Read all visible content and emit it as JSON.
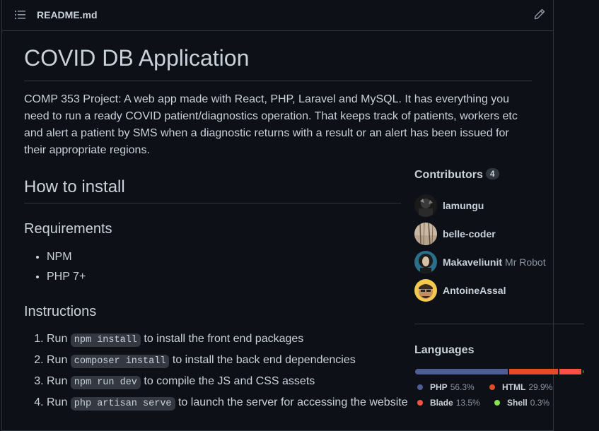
{
  "readme": {
    "filename": "README.md",
    "title": "COVID DB Application",
    "description": "COMP 353 Project: A web app made with React, PHP, Laravel and MySQL. It has everything you need to run a ready COVID patient/diagnostics operation. That keeps track of patients, workers etc and alert a patient by SMS when a diagnostic returns with a result or an alert has been issued for their appropriate regions.",
    "install_heading": "How to install",
    "requirements_heading": "Requirements",
    "requirements": [
      "NPM",
      "PHP 7+"
    ],
    "instructions_heading": "Instructions",
    "steps": [
      {
        "pre": "Run ",
        "code": "npm install",
        "post": " to install the front end packages"
      },
      {
        "pre": "Run ",
        "code": "composer install",
        "post": " to install the back end dependencies"
      },
      {
        "pre": "Run ",
        "code": "npm run dev",
        "post": " to compile the JS and CSS assets"
      },
      {
        "pre": "Run ",
        "code": "php artisan serve",
        "post": " to launch the server for accessing the website"
      }
    ]
  },
  "contributors": {
    "title": "Contributors",
    "count": "4",
    "list": [
      {
        "name": "lamungu",
        "extra": ""
      },
      {
        "name": "belle-coder",
        "extra": ""
      },
      {
        "name": "Makaveliunit",
        "extra": "Mr Robot"
      },
      {
        "name": "AntoineAssal",
        "extra": ""
      }
    ]
  },
  "languages": {
    "title": "Languages",
    "items": [
      {
        "name": "PHP",
        "percent": "56.3%",
        "value": 56.3,
        "color": "#4F5D95"
      },
      {
        "name": "HTML",
        "percent": "29.9%",
        "value": 29.9,
        "color": "#e34c26"
      },
      {
        "name": "Blade",
        "percent": "13.5%",
        "value": 13.5,
        "color": "#f7523f"
      },
      {
        "name": "Shell",
        "percent": "0.3%",
        "value": 0.3,
        "color": "#89e051"
      }
    ]
  }
}
